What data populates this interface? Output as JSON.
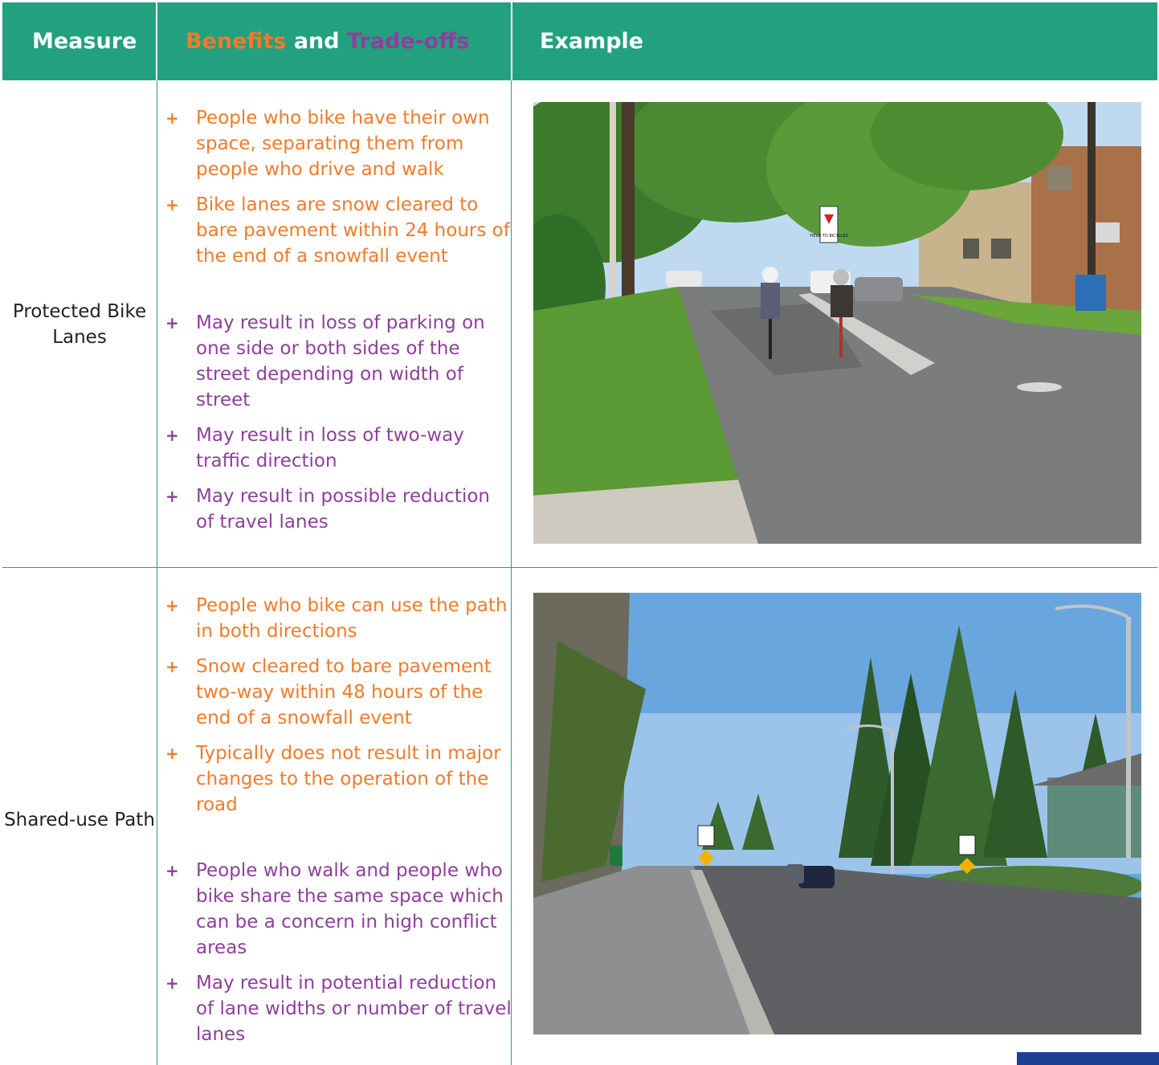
{
  "header": {
    "measure": "Measure",
    "benefits_word": "Benefits",
    "and_word": " and ",
    "tradeoffs_word": "Trade-offs",
    "example": "Example"
  },
  "colors": {
    "header_bg": "#22a07f",
    "benefit": "#ef7b2b",
    "tradeoff": "#8e3f9b"
  },
  "rows": [
    {
      "measure": "Protected Bike Lanes",
      "benefits": [
        "People who bike have their own space, separating them from people who drive and walk",
        "Bike lanes are snow cleared to bare pavement within 24 hours of the end of a snowfall event"
      ],
      "tradeoffs": [
        "May result in loss of parking on one side or both sides of the street depending on width of street",
        "May result in loss of two-way traffic direction",
        "May result in possible reduction of travel lanes"
      ],
      "sign_text": "YIELD TO BICYCLES"
    },
    {
      "measure": "Shared-use Path",
      "benefits": [
        "People who bike can use the path in both directions",
        "Snow cleared to bare pavement two-way within 48 hours of the end of a snowfall event",
        "Typically does not result in major changes to the operation of the road"
      ],
      "tradeoffs": [
        "People who walk and people who bike share the same space which can be a concern in high conflict areas",
        "May result in potential reduction of lane widths or number of travel lanes"
      ]
    }
  ],
  "bullet_symbol": "+"
}
